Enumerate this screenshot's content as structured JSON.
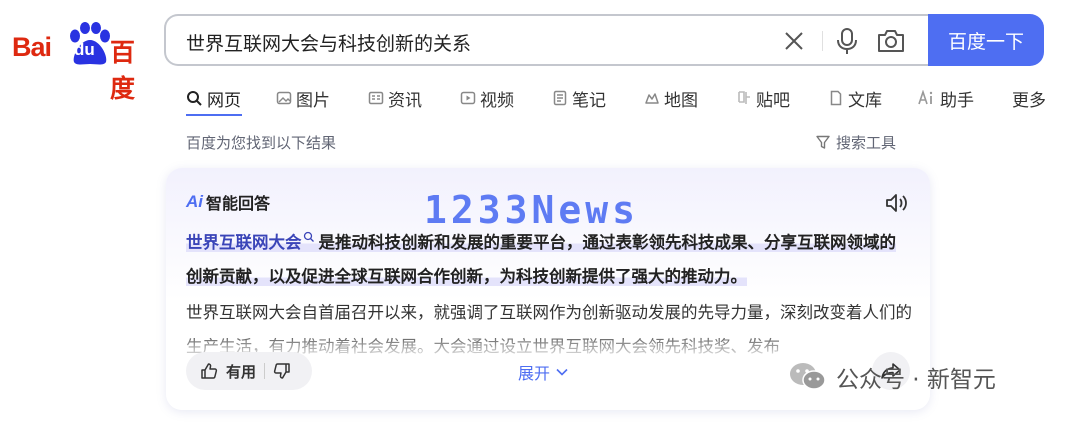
{
  "logo": {
    "latin_part": "Bai",
    "paw_part": "du",
    "chinese_part": "百度"
  },
  "search": {
    "query": "世界互联网大会与科技创新的关系",
    "button_label": "百度一下",
    "icons": [
      "close-icon",
      "microphone-icon",
      "camera-icon"
    ]
  },
  "tabs": [
    {
      "label": "网页",
      "icon": "search-icon",
      "active": true
    },
    {
      "label": "图片",
      "icon": "image-icon"
    },
    {
      "label": "资讯",
      "icon": "news-icon"
    },
    {
      "label": "视频",
      "icon": "video-icon"
    },
    {
      "label": "笔记",
      "icon": "note-icon"
    },
    {
      "label": "地图",
      "icon": "map-icon"
    },
    {
      "label": "贴吧",
      "icon": "tieba-icon"
    },
    {
      "label": "文库",
      "icon": "library-icon"
    },
    {
      "label": "助手",
      "icon": "ai-icon"
    },
    {
      "label": "更多"
    }
  ],
  "results_meta": {
    "count_text": "百度为您找到以下结果",
    "tools_label": "搜索工具"
  },
  "ai_answer": {
    "logo": "Ai",
    "title": "智能回答",
    "link_term": "世界互联网大会",
    "summary_rest": "是推动科技创新和发展的重要平台，通过表彰领先科技成果、分享互联网领域的创新贡献，以及促进全球互联网合作创新，为科技创新提供了强大的推动力。",
    "detail_text": "世界互联网大会自首届召开以来，就强调了互联网作为创新驱动发展的先导力量，深刻改变着人们的生产生活，有力推动着社会发展。大会通过设立世界互联网大会领先科技奖、发布",
    "useful_label": "有用",
    "expand_label": "展开"
  },
  "overlays": {
    "watermark": "1233News",
    "wechat_label": "公众号 · 新智元"
  },
  "colors": {
    "brand_blue": "#4e6ef2",
    "baidu_red": "#de2910",
    "link_color": "#3a45b8"
  }
}
